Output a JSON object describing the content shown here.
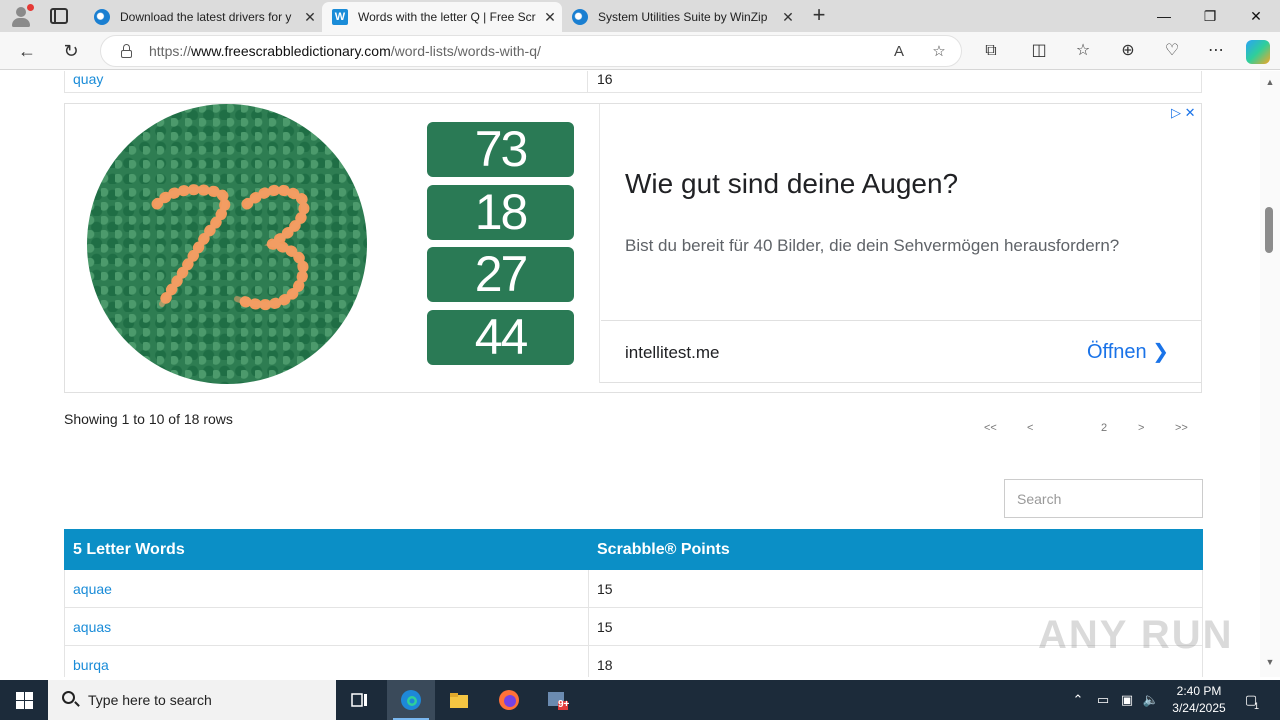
{
  "browser": {
    "tabs": [
      {
        "title": "Download the latest drivers for y",
        "favicon": "edge-page-icon",
        "active": false
      },
      {
        "title": "Words with the letter Q | Free Scr",
        "favicon": "w-favicon-icon",
        "active": true
      },
      {
        "title": "System Utilities Suite by WinZip",
        "favicon": "edge-page-icon",
        "active": false
      }
    ],
    "new_tab": "+",
    "url_prefix": "https://",
    "url_domain": "www.freescrabbledictionary.com",
    "url_path": "/word-lists/words-with-q/",
    "controls": {
      "minimize": "—",
      "maximize": "❐",
      "close": "✕"
    }
  },
  "page": {
    "previous_row": {
      "word": "quay",
      "points": "16"
    },
    "ad": {
      "numbers": [
        "73",
        "18",
        "27",
        "44"
      ],
      "headline": "Wie gut sind deine Augen?",
      "description": "Bist du bereit für 40 Bilder, die dein Sehvermögen herausfordern?",
      "domain": "intellitest.me",
      "cta": "Öffnen",
      "choices": "▷ ✕"
    },
    "showing": "Showing 1 to 10 of 18 rows",
    "pager": {
      "first": "<<",
      "prev": "<",
      "page": "2",
      "next": ">",
      "last": ">>"
    },
    "search": {
      "placeholder": "Search"
    },
    "table": {
      "headers": [
        "5 Letter Words",
        "Scrabble® Points"
      ],
      "rows": [
        {
          "word": "aquae",
          "points": "15"
        },
        {
          "word": "aquas",
          "points": "15"
        },
        {
          "word": "burqa",
          "points": "18"
        }
      ]
    },
    "watermark": "ANY RUN"
  },
  "taskbar": {
    "search_placeholder": "Type here to search",
    "time": "2:40 PM",
    "date": "3/24/2025",
    "notification_count": "1",
    "badge": "9+"
  }
}
